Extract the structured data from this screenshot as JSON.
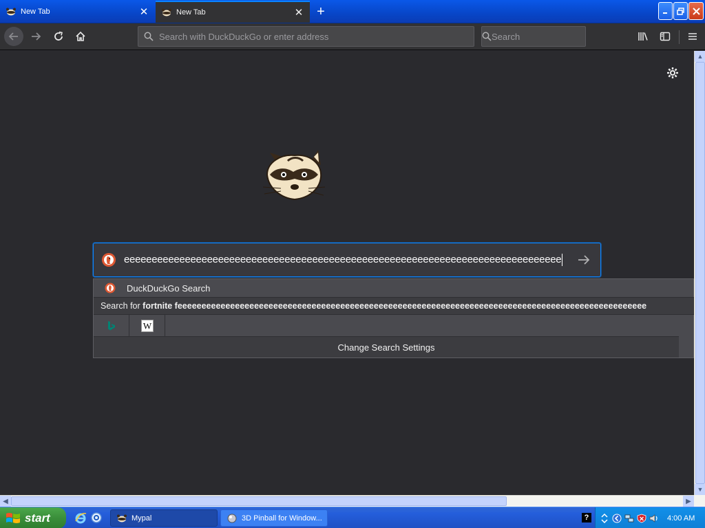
{
  "tabs": [
    {
      "title": "New Tab",
      "active": false
    },
    {
      "title": "New Tab",
      "active": true
    }
  ],
  "toolbar": {
    "url_placeholder": "Search with DuckDuckGo or enter address",
    "search_placeholder": "Search"
  },
  "newtab_page": {
    "search_query": "eeeeeeeeeeeeeeeeeeeeeeeeeeeeeeeeeeeeeeeeeeeeeeeeeeeeeeeeeeeeeeeeeeeeeeeeeeeeeee",
    "engine_icon": "duckduckgo-icon"
  },
  "suggestions": {
    "engine_label": "DuckDuckGo Search",
    "search_for_prefix": "Search for ",
    "search_for_term": "fortnite feeeeeeeeeeeeeeeeeeeeeeeeeeeeeeeeeeeeeeeeeeeeeeeeeeeeeeeeeeeeeeeeeeeeeeeeeeeeeeeeeeeeeeeeeeeeeeeeee",
    "one_off_engines": [
      "bing-icon",
      "wikipedia-icon"
    ],
    "settings_label": "Change Search Settings"
  },
  "taskbar": {
    "start_label": "start",
    "items": [
      {
        "label": "Mypal",
        "active": true
      },
      {
        "label": "3D Pinball for Window...",
        "active": false
      }
    ],
    "clock": "4:00 AM"
  },
  "colors": {
    "accent": "#0a84ff",
    "page_bg": "#2a2a2e",
    "toolbar_bg": "#323234"
  }
}
